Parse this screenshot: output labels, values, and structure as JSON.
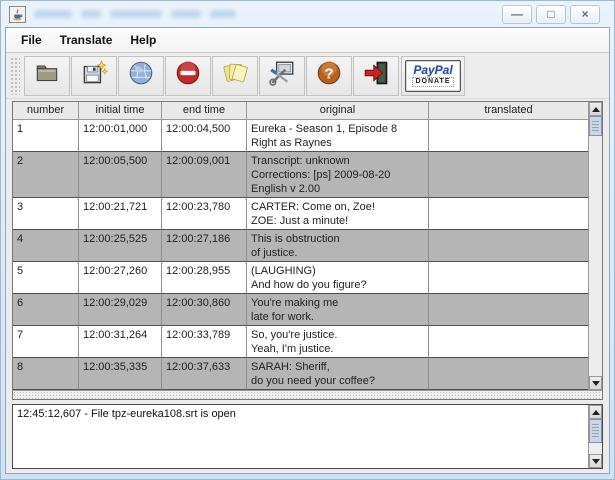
{
  "window": {
    "controls": {
      "minimize": "—",
      "maximize": "□",
      "close": "×"
    }
  },
  "menu": {
    "items": [
      {
        "label": "File"
      },
      {
        "label": "Translate"
      },
      {
        "label": "Help"
      }
    ]
  },
  "toolbar": {
    "icons": [
      "folder-open",
      "save-as-sparkle",
      "globe",
      "stop-sign",
      "notes-stack",
      "tools",
      "help-question",
      "exit-door"
    ],
    "paypal": {
      "line1": "PayPal",
      "line2": "DONATE"
    }
  },
  "table": {
    "columns": [
      "number",
      "initial time",
      "end time",
      "original",
      "translated"
    ],
    "rows": [
      {
        "number": "1",
        "initial_time": "12:00:01,000",
        "end_time": "12:00:04,500",
        "original": "Eureka - Season 1, Episode 8\nRight as Raynes",
        "translated": ""
      },
      {
        "number": "2",
        "initial_time": "12:00:05,500",
        "end_time": "12:00:09,001",
        "original": "Transcript: unknown\nCorrections: [ps] 2009-08-20\nEnglish v 2.00",
        "translated": ""
      },
      {
        "number": "3",
        "initial_time": "12:00:21,721",
        "end_time": "12:00:23,780",
        "original": "CARTER: Come on, Zoe!\nZOE: Just a minute!",
        "translated": ""
      },
      {
        "number": "4",
        "initial_time": "12:00:25,525",
        "end_time": "12:00:27,186",
        "original": "This is obstruction\nof justice.",
        "translated": ""
      },
      {
        "number": "5",
        "initial_time": "12:00:27,260",
        "end_time": "12:00:28,955",
        "original": "(LAUGHING)\nAnd how do you figure?",
        "translated": ""
      },
      {
        "number": "6",
        "initial_time": "12:00:29,029",
        "end_time": "12:00:30,860",
        "original": "You're making me\nlate for work.",
        "translated": ""
      },
      {
        "number": "7",
        "initial_time": "12:00:31,264",
        "end_time": "12:00:33,789",
        "original": "So, you're justice.\nYeah, I'm justice.",
        "translated": ""
      },
      {
        "number": "8",
        "initial_time": "12:00:35,335",
        "end_time": "12:00:37,633",
        "original": "SARAH: Sheriff,\ndo you need your coffee?",
        "translated": ""
      }
    ]
  },
  "status_log": {
    "text": "12:45:12,607 - File tpz-eureka108.srt is open"
  },
  "colors": {
    "row_alt": "#b5b5b5",
    "titlebar": "#d7e7f7",
    "help_icon": "#b4621e",
    "stop_icon": "#c32b2b",
    "paypal_blue": "#2a4f9e"
  }
}
